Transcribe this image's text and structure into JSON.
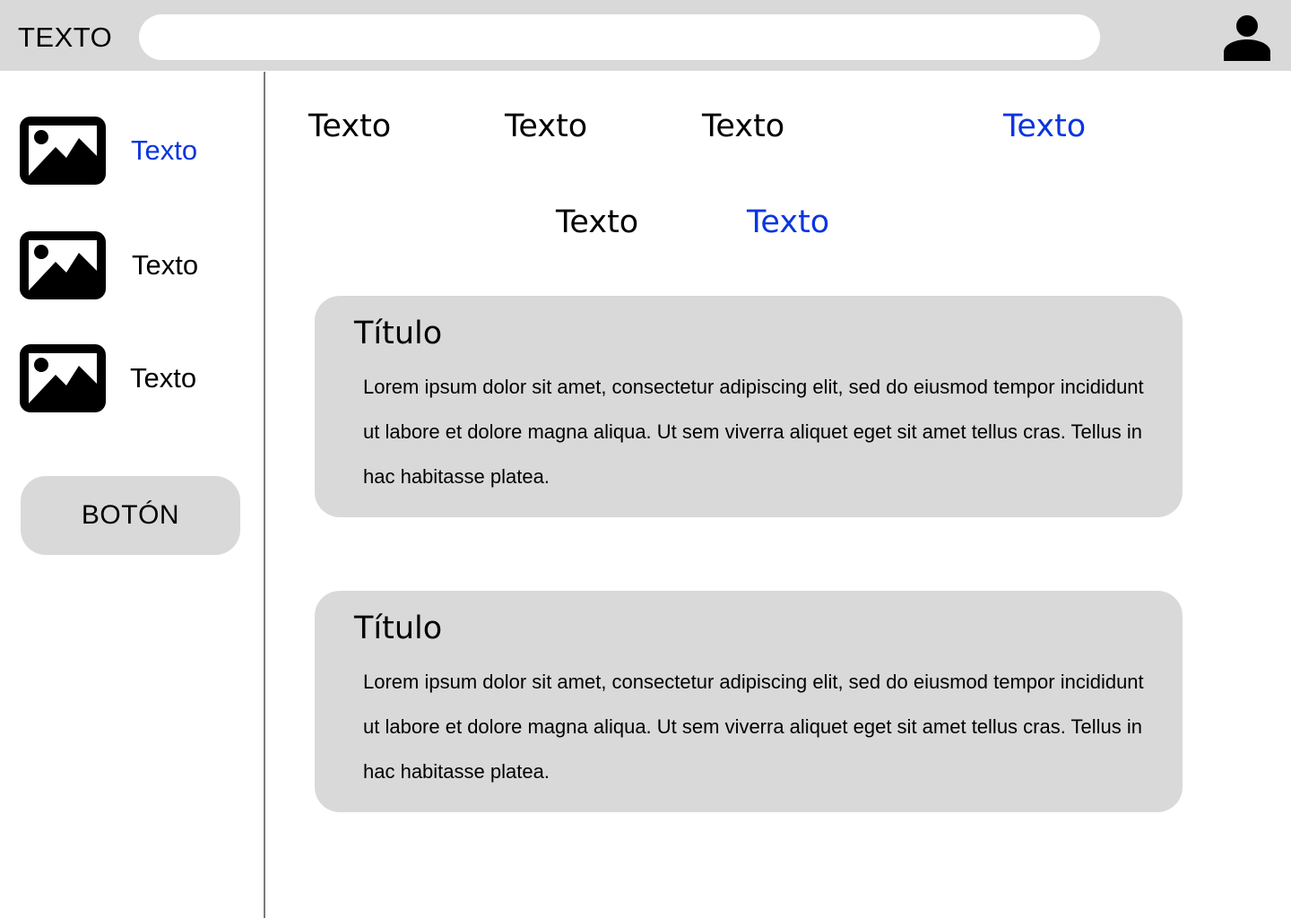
{
  "header": {
    "brand": "TEXTO",
    "search": {
      "value": "",
      "placeholder": ""
    },
    "user_icon": "user-icon"
  },
  "sidebar": {
    "items": [
      {
        "label": "Texto",
        "icon": "image-icon",
        "active": true
      },
      {
        "label": "Texto",
        "icon": "image-icon",
        "active": false
      },
      {
        "label": "Texto",
        "icon": "image-icon",
        "active": false
      }
    ],
    "button_label": "BOTÓN"
  },
  "main": {
    "tabs_row1": [
      {
        "label": "Texto",
        "active": false
      },
      {
        "label": "Texto",
        "active": false
      },
      {
        "label": "Texto",
        "active": false
      },
      {
        "label": "Texto",
        "active": true
      }
    ],
    "tabs_row2": [
      {
        "label": "Texto",
        "active": false
      },
      {
        "label": "Texto",
        "active": true
      }
    ],
    "cards": [
      {
        "title": "Título",
        "body": "Lorem ipsum dolor sit amet, consectetur adipiscing elit, sed do eiusmod tempor incididunt ut labore et dolore magna aliqua. Ut sem viverra aliquet eget sit amet tellus cras. Tellus in hac habitasse platea."
      },
      {
        "title": "Título",
        "body": "Lorem ipsum dolor sit amet, consectetur adipiscing elit, sed do eiusmod tempor incididunt ut labore et dolore magna aliqua. Ut sem viverra aliquet eget sit amet tellus cras. Tellus in hac habitasse platea."
      }
    ]
  },
  "colors": {
    "accent": "#0a35e0",
    "panel": "#d9d9d9",
    "divider": "#7a7a7a",
    "text": "#000000"
  }
}
